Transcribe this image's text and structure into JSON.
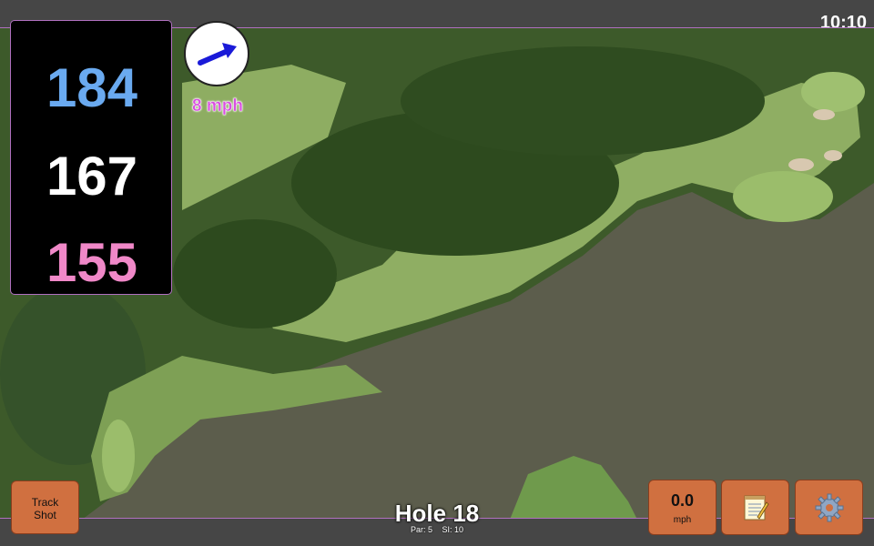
{
  "status": {
    "time": "10:10"
  },
  "yardages": {
    "back": "184",
    "middle": "167",
    "front": "155",
    "colors": {
      "back": "#6aaaf0",
      "middle": "#ffffff",
      "front": "#f088c8"
    }
  },
  "wind": {
    "speed_label": "8 mph",
    "direction_icon": "wind-arrow-icon"
  },
  "hole": {
    "title": "Hole 18",
    "par": "Par: 5",
    "stroke_index": "SI: 10"
  },
  "buttons": {
    "track_shot_line1": "Track",
    "track_shot_line2": "Shot",
    "speed_value": "0.0",
    "speed_unit": "mph",
    "notes_icon": "notepad-icon",
    "settings_icon": "gear-icon"
  },
  "colors": {
    "button": "#d07040",
    "accent": "#b070c0",
    "bar": "#464646"
  }
}
